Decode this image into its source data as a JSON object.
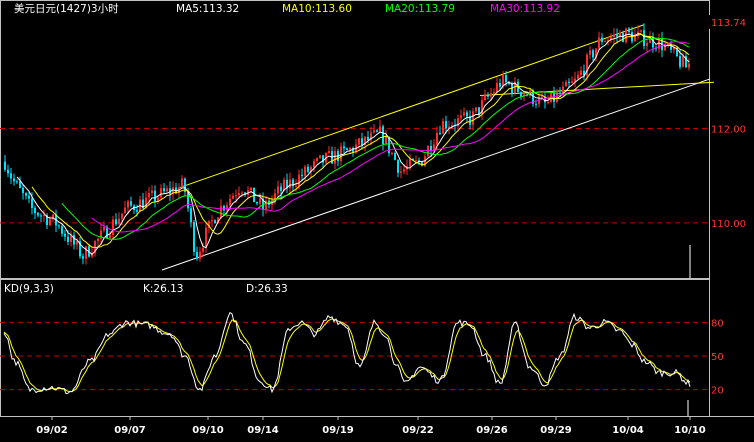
{
  "chart_data": {
    "type": "candlestick",
    "title": "美元日元(1427)3小时",
    "last_price": "113.74",
    "ma_legend": [
      {
        "label": "MA5:113.32",
        "color": "#ffffff"
      },
      {
        "label": "MA10:113.60",
        "color": "#ffff00"
      },
      {
        "label": "MA20:113.79",
        "color": "#00ff00"
      },
      {
        "label": "MA30:113.92",
        "color": "#ff00ff"
      }
    ],
    "price_axis": {
      "ylim": [
        109.0,
        114.3
      ],
      "ticks": [
        {
          "value": 112.0,
          "label": "112.00"
        },
        {
          "value": 110.0,
          "label": "110.00"
        }
      ]
    },
    "kd": {
      "label": "KD(9,3,3)",
      "k_label": "K:26.13",
      "d_label": "D:26.33",
      "ylim": [
        0,
        100
      ],
      "ticks": [
        {
          "value": 80,
          "label": "80"
        },
        {
          "value": 50,
          "label": "50"
        },
        {
          "value": 20,
          "label": "20"
        }
      ],
      "k_color": "#ffffff",
      "d_color": "#ffff00"
    },
    "x_labels": [
      "09/02",
      "09/07",
      "09/10",
      "09/14",
      "09/19",
      "09/22",
      "09/26",
      "09/29",
      "10/04",
      "10/10"
    ],
    "candle_colors": {
      "up": "#ff2a2a",
      "down": "#00e0ff"
    },
    "trend_lines": [
      {
        "name": "channel-upper",
        "from": [
          "09/10",
          110.7
        ],
        "to": [
          "10/04",
          114.15
        ],
        "color": "#ffff00"
      },
      {
        "name": "channel-lower",
        "from": [
          "09/07",
          108.95
        ],
        "to": [
          "10/10",
          113.0
        ],
        "color": "#ffffff"
      },
      {
        "name": "support-line",
        "from": [
          "09/26",
          112.6
        ],
        "to": [
          "10/10",
          112.95
        ],
        "color": "#ffff00"
      }
    ]
  }
}
